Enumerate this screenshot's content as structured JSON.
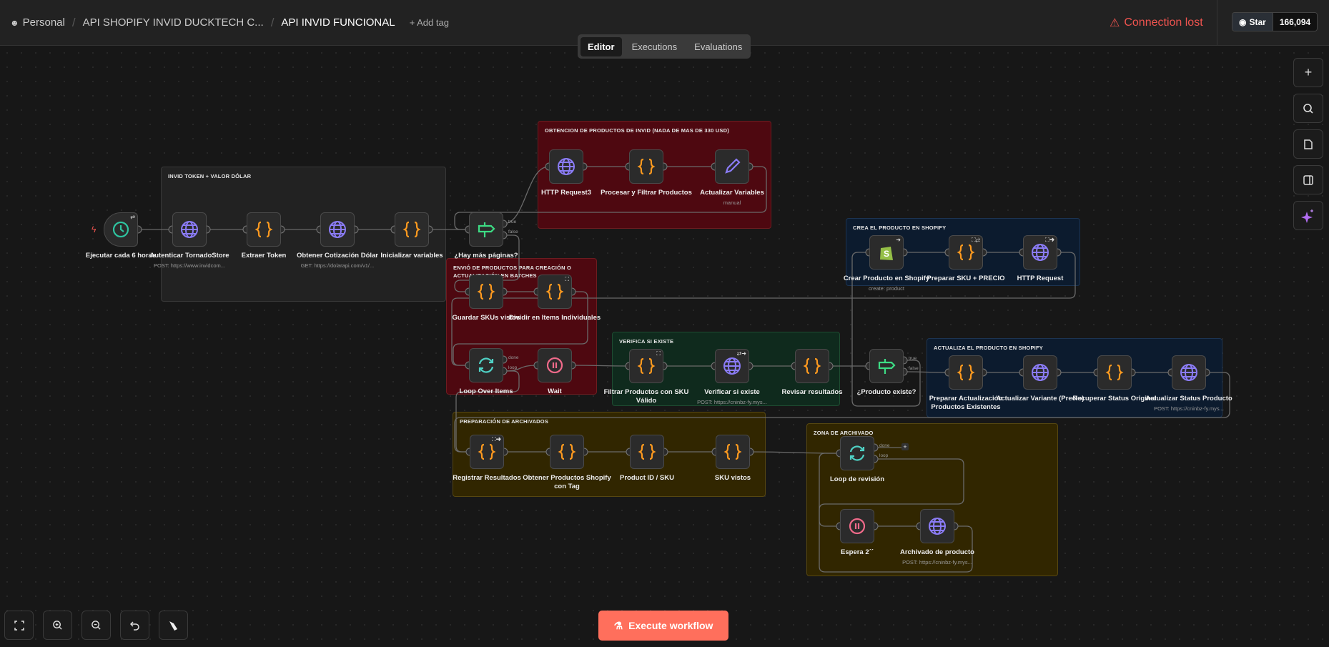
{
  "header": {
    "breadcrumb": [
      "Personal",
      "API SHOPIFY INVID DUCKTECH C...",
      "API INVID FUNCIONAL"
    ],
    "add_tag": "+ Add tag",
    "connection_status": "Connection lost",
    "github": {
      "star_label": "Star",
      "star_count": "166,094"
    },
    "tabs": [
      {
        "label": "Editor",
        "active": true
      },
      {
        "label": "Executions"
      },
      {
        "label": "Evaluations"
      }
    ]
  },
  "colors": {
    "accent": "#ff6f5c",
    "error": "#f0544f",
    "globe": "#8b7cf6",
    "code": "#ff9a1f",
    "schedule": "#2ec4a0",
    "if": "#3ddc84",
    "wait": "#f06a8a",
    "shopify": "#95bf47"
  },
  "groups": [
    {
      "id": "g1",
      "title": "INVID TOKEN + VALOR DÓLAR",
      "color": "grey"
    },
    {
      "id": "g2",
      "title": "OBTENCION DE PRODUCTOS DE INVID (NADA DE MAS DE 330 USD)",
      "color": "red"
    },
    {
      "id": "g3",
      "title": "ENVIÓ DE PRODUCTOS PARA CREACIÓN O ACTUALIZACIÓN EN BATCHES",
      "color": "red"
    },
    {
      "id": "g4",
      "title": "VERIFICA SI EXISTE",
      "color": "green"
    },
    {
      "id": "g5",
      "title": "CREA EL PRODUCTO EN SHOPIFY",
      "color": "blue"
    },
    {
      "id": "g6",
      "title": "ACTUALIZA EL PRODUCTO EN SHOPIFY",
      "color": "blue"
    },
    {
      "id": "g7",
      "title": "PREPARACIÓN DE ARCHIVADOS",
      "color": "yellow"
    },
    {
      "id": "g8",
      "title": "ZONA DE ARCHIVADO",
      "color": "yellow"
    }
  ],
  "nodes": [
    {
      "id": "trigger",
      "label": "Ejecutar cada 6 horas",
      "icon": "clock-icon",
      "badge": "⇄"
    },
    {
      "id": "auth",
      "label": "Autenticar TornadoStore",
      "sub": "POST: https://www.invidcom...",
      "icon": "globe-icon"
    },
    {
      "id": "extraer",
      "label": "Extraer Token",
      "icon": "code-braces-icon"
    },
    {
      "id": "dolar",
      "label": "Obtener Cotización Dólar",
      "sub": "GET: https://dolarapi.com/v1/...",
      "icon": "globe-icon"
    },
    {
      "id": "init",
      "label": "Inicializar variables",
      "icon": "code-braces-icon"
    },
    {
      "id": "hay",
      "label": "¿Hay más páginas?",
      "icon": "signpost-icon",
      "outputs": [
        "true",
        "false"
      ]
    },
    {
      "id": "http3",
      "label": "HTTP Request3",
      "icon": "globe-icon"
    },
    {
      "id": "procesar",
      "label": "Procesar y Filtrar Productos",
      "icon": "code-braces-icon"
    },
    {
      "id": "actvars",
      "label": "Actualizar Variables",
      "sub": "manual",
      "icon": "pencil-icon"
    },
    {
      "id": "guardar",
      "label": "Guardar SKUs vistos",
      "icon": "code-braces-icon"
    },
    {
      "id": "dividir",
      "label": "Dividir en Items Individuales",
      "icon": "code-braces-icon",
      "badge": "⛶"
    },
    {
      "id": "loop",
      "label": "Loop Over Items",
      "icon": "loop-arrows-icon",
      "outputs": [
        "done",
        "loop"
      ]
    },
    {
      "id": "wait",
      "label": "Wait",
      "icon": "pause-icon"
    },
    {
      "id": "filtrar",
      "label": "Filtrar Productos con SKU Válido",
      "icon": "code-braces-icon",
      "badge": "⛶"
    },
    {
      "id": "verificar",
      "label": "Verificar si existe",
      "sub": "POST: https://cninbz-fy.mys...",
      "icon": "globe-icon",
      "badge": "⇄➜"
    },
    {
      "id": "revisar",
      "label": "Revisar resultados",
      "icon": "code-braces-icon"
    },
    {
      "id": "existe",
      "label": "¿Producto existe?",
      "icon": "signpost-icon",
      "outputs": [
        "true",
        "false"
      ]
    },
    {
      "id": "crear",
      "label": "Crear Producto en Shopify",
      "sub": "create: product",
      "icon": "shopify-icon",
      "badge": "➜"
    },
    {
      "id": "prepsku",
      "label": "Preparar SKU + PRECIO",
      "icon": "code-braces-icon",
      "badge": "⛶⇄"
    },
    {
      "id": "httpreq",
      "label": "HTTP Request",
      "icon": "globe-icon",
      "badge": "⛶➜"
    },
    {
      "id": "prepact",
      "label": "Preparar Actualización Productos Existentes",
      "icon": "code-braces-icon"
    },
    {
      "id": "actvar",
      "label": "Actualizar Variante (Precio)",
      "icon": "globe-icon"
    },
    {
      "id": "recuperar",
      "label": "Recuperar Status Original",
      "icon": "code-braces-icon"
    },
    {
      "id": "actstatus",
      "label": "Actualizar Status Producto",
      "sub": "POST: https://cninbz-fy.mys...",
      "icon": "globe-icon"
    },
    {
      "id": "registrar",
      "label": "Registrar Resultados",
      "icon": "code-braces-icon",
      "badge": "⛶➜"
    },
    {
      "id": "obtshop",
      "label": "Obtener Productos Shopify con Tag",
      "icon": "code-braces-icon"
    },
    {
      "id": "prodid",
      "label": "Product ID / SKU",
      "icon": "code-braces-icon"
    },
    {
      "id": "skuvistos",
      "label": "SKU vistos",
      "icon": "code-braces-icon"
    },
    {
      "id": "looprev",
      "label": "Loop de revisión",
      "icon": "loop-arrows-icon",
      "outputs": [
        "done",
        "loop"
      ]
    },
    {
      "id": "espera",
      "label": "Espera 2´´",
      "icon": "pause-icon"
    },
    {
      "id": "archivado",
      "label": "Archivado de producto",
      "sub": "POST: https://cninbz-fy.mys...",
      "icon": "globe-icon"
    }
  ],
  "right_toolbar": [
    {
      "name": "add-node",
      "icon": "plus-icon"
    },
    {
      "name": "search",
      "icon": "search-icon"
    },
    {
      "name": "sticky-note",
      "icon": "note-icon"
    },
    {
      "name": "toggle-panel",
      "icon": "panel-icon"
    },
    {
      "name": "ai-assistant",
      "icon": "sparkle-icon"
    }
  ],
  "bottom_toolbar": [
    {
      "name": "fit-view",
      "icon": "fullscreen-icon"
    },
    {
      "name": "zoom-in",
      "icon": "zoom-in-icon"
    },
    {
      "name": "zoom-out",
      "icon": "zoom-out-icon"
    },
    {
      "name": "undo",
      "icon": "undo-icon"
    },
    {
      "name": "tidy-up",
      "icon": "broom-icon"
    }
  ],
  "execute_button": "Execute workflow"
}
